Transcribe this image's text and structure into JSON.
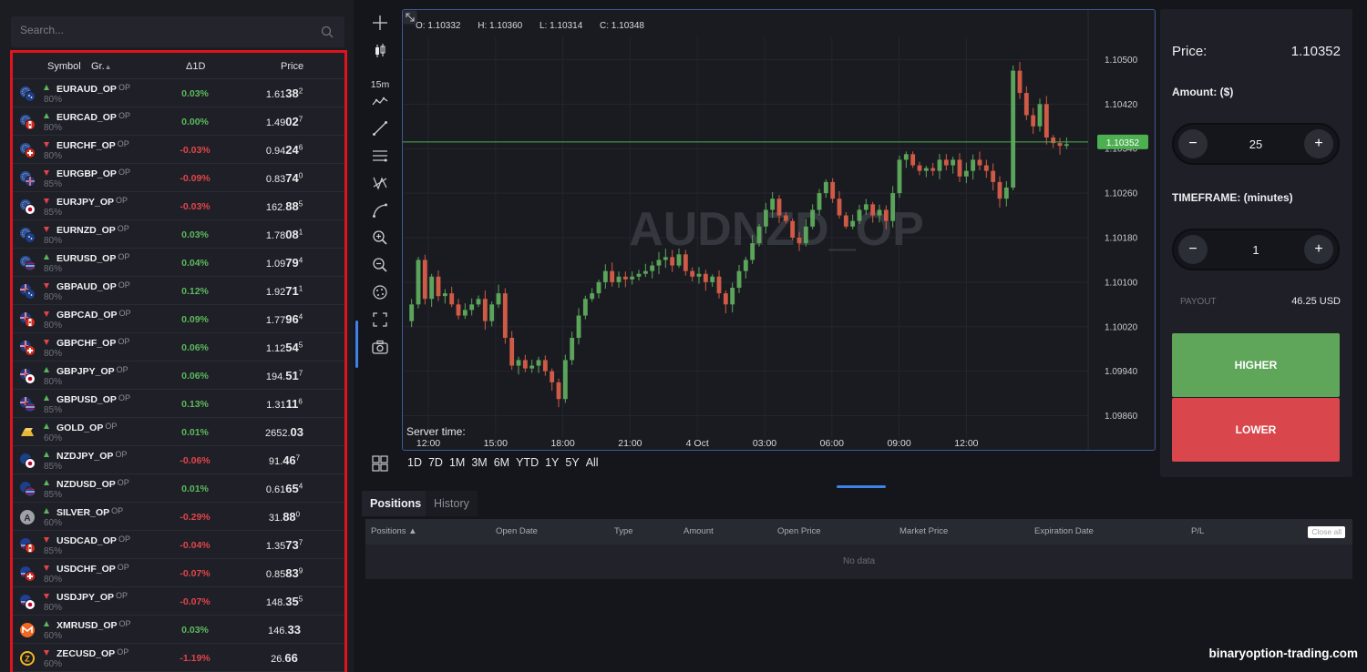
{
  "search": {
    "placeholder": "Search..."
  },
  "instruments": {
    "headers": {
      "symbol": "Symbol",
      "group": "Gr.",
      "change": "Δ1D",
      "price": "Price"
    },
    "rows": [
      {
        "symbol": "EURAUD_OP",
        "tag": "OP",
        "payout": "80%",
        "dir": "up",
        "change": "0.03%",
        "pre": "1.61",
        "big": "38",
        "sup": "2",
        "flag": "eu-au"
      },
      {
        "symbol": "EURCAD_OP",
        "tag": "OP",
        "payout": "80%",
        "dir": "up",
        "change": "0.00%",
        "pre": "1.49",
        "big": "02",
        "sup": "7",
        "flag": "eu-ca"
      },
      {
        "symbol": "EURCHF_OP",
        "tag": "OP",
        "payout": "80%",
        "dir": "down",
        "change": "-0.03%",
        "pre": "0.94",
        "big": "24",
        "sup": "6",
        "flag": "eu-ch"
      },
      {
        "symbol": "EURGBP_OP",
        "tag": "OP",
        "payout": "85%",
        "dir": "down",
        "change": "-0.09%",
        "pre": "0.83",
        "big": "74",
        "sup": "0",
        "flag": "eu-gb"
      },
      {
        "symbol": "EURJPY_OP",
        "tag": "OP",
        "payout": "85%",
        "dir": "down",
        "change": "-0.03%",
        "pre": "162.",
        "big": "88",
        "sup": "5",
        "flag": "eu-jp"
      },
      {
        "symbol": "EURNZD_OP",
        "tag": "OP",
        "payout": "80%",
        "dir": "down",
        "change": "0.03%",
        "pre": "1.78",
        "big": "08",
        "sup": "1",
        "flag": "eu-nz"
      },
      {
        "symbol": "EURUSD_OP",
        "tag": "OP",
        "payout": "86%",
        "dir": "up",
        "change": "0.04%",
        "pre": "1.09",
        "big": "79",
        "sup": "4",
        "flag": "eu-us"
      },
      {
        "symbol": "GBPAUD_OP",
        "tag": "OP",
        "payout": "80%",
        "dir": "down",
        "change": "0.12%",
        "pre": "1.92",
        "big": "71",
        "sup": "1",
        "flag": "gb-au"
      },
      {
        "symbol": "GBPCAD_OP",
        "tag": "OP",
        "payout": "80%",
        "dir": "down",
        "change": "0.09%",
        "pre": "1.77",
        "big": "96",
        "sup": "4",
        "flag": "gb-ca"
      },
      {
        "symbol": "GBPCHF_OP",
        "tag": "OP",
        "payout": "80%",
        "dir": "down",
        "change": "0.06%",
        "pre": "1.12",
        "big": "54",
        "sup": "5",
        "flag": "gb-ch"
      },
      {
        "symbol": "GBPJPY_OP",
        "tag": "OP",
        "payout": "80%",
        "dir": "up",
        "change": "0.06%",
        "pre": "194.",
        "big": "51",
        "sup": "7",
        "flag": "gb-jp"
      },
      {
        "symbol": "GBPUSD_OP",
        "tag": "OP",
        "payout": "85%",
        "dir": "up",
        "change": "0.13%",
        "pre": "1.31",
        "big": "11",
        "sup": "6",
        "flag": "gb-us"
      },
      {
        "symbol": "GOLD_OP",
        "tag": "OP",
        "payout": "60%",
        "dir": "up",
        "change": "0.01%",
        "pre": "2652.",
        "big": "03",
        "sup": "",
        "flag": "gold"
      },
      {
        "symbol": "NZDJPY_OP",
        "tag": "OP",
        "payout": "85%",
        "dir": "up",
        "change": "-0.06%",
        "pre": "91.",
        "big": "46",
        "sup": "7",
        "flag": "nz-jp"
      },
      {
        "symbol": "NZDUSD_OP",
        "tag": "OP",
        "payout": "85%",
        "dir": "up",
        "change": "0.01%",
        "pre": "0.61",
        "big": "65",
        "sup": "4",
        "flag": "nz-us"
      },
      {
        "symbol": "SILVER_OP",
        "tag": "OP",
        "payout": "60%",
        "dir": "up",
        "change": "-0.29%",
        "pre": "31.",
        "big": "88",
        "sup": "0",
        "flag": "silver"
      },
      {
        "symbol": "USDCAD_OP",
        "tag": "OP",
        "payout": "85%",
        "dir": "down",
        "change": "-0.04%",
        "pre": "1.35",
        "big": "73",
        "sup": "7",
        "flag": "us-ca"
      },
      {
        "symbol": "USDCHF_OP",
        "tag": "OP",
        "payout": "80%",
        "dir": "down",
        "change": "-0.07%",
        "pre": "0.85",
        "big": "83",
        "sup": "9",
        "flag": "us-ch"
      },
      {
        "symbol": "USDJPY_OP",
        "tag": "OP",
        "payout": "80%",
        "dir": "down",
        "change": "-0.07%",
        "pre": "148.",
        "big": "35",
        "sup": "5",
        "flag": "us-jp"
      },
      {
        "symbol": "XMRUSD_OP",
        "tag": "OP",
        "payout": "60%",
        "dir": "up",
        "change": "0.03%",
        "pre": "146.",
        "big": "33",
        "sup": "",
        "flag": "xmr"
      },
      {
        "symbol": "ZECUSD_OP",
        "tag": "OP",
        "payout": "60%",
        "dir": "down",
        "change": "-1.19%",
        "pre": "26.",
        "big": "66",
        "sup": "",
        "flag": "zec"
      }
    ]
  },
  "toolbar": {
    "timeframe": "15m"
  },
  "chart": {
    "ohlc": {
      "open": "O: 1.10332",
      "high": "H: 1.10360",
      "low": "L: 1.10314",
      "close": "C: 1.10348"
    },
    "watermark": "AUDNZD_OP",
    "server_time": "Server time:",
    "current_price": "1.10352",
    "ranges": [
      "1D",
      "7D",
      "1M",
      "3M",
      "6M",
      "YTD",
      "1Y",
      "5Y",
      "All"
    ]
  },
  "chart_data": {
    "type": "candlestick",
    "y_ticks": [
      "1.10500",
      "1.10420",
      "1.10340",
      "1.10260",
      "1.10180",
      "1.10100",
      "1.10020",
      "1.09940",
      "1.09860"
    ],
    "ylim": [
      1.0982,
      1.1054
    ],
    "x_ticks": [
      "12:00",
      "15:00",
      "18:00",
      "21:00",
      "4 Oct",
      "03:00",
      "06:00",
      "09:00",
      "12:00"
    ],
    "last_price": 1.10352,
    "line_color": "#4caf50",
    "up_color": "#5ba55a",
    "down_color": "#cf5a45",
    "closes": [
      1.1006,
      1.1014,
      1.1007,
      1.1011,
      1.10075,
      1.1008,
      1.1006,
      1.1004,
      1.1005,
      1.1006,
      1.1007,
      1.1003,
      1.1006,
      1.1008,
      1.1,
      1.0995,
      1.0996,
      1.09945,
      1.0995,
      1.0996,
      1.0994,
      1.0992,
      1.0989,
      1.0996,
      1.1,
      1.1004,
      1.1007,
      1.1008,
      1.101,
      1.1012,
      1.101,
      1.1011,
      1.10105,
      1.1011,
      1.10115,
      1.1012,
      1.1013,
      1.1014,
      1.10145,
      1.1013,
      1.1015,
      1.1012,
      1.1011,
      1.10115,
      1.101,
      1.1011,
      1.1008,
      1.1006,
      1.1009,
      1.1012,
      1.1014,
      1.1017,
      1.102,
      1.1023,
      1.1025,
      1.1022,
      1.1021,
      1.1018,
      1.1017,
      1.102,
      1.1023,
      1.1026,
      1.1028,
      1.1025,
      1.1022,
      1.102,
      1.1021,
      1.1023,
      1.1024,
      1.1022,
      1.1023,
      1.1021,
      1.1026,
      1.1032,
      1.1033,
      1.1031,
      1.103,
      1.10305,
      1.103,
      1.1032,
      1.1031,
      1.1032,
      1.1029,
      1.103,
      1.1032,
      1.1031,
      1.103,
      1.1028,
      1.1025,
      1.1027,
      1.1048,
      1.1044,
      1.104,
      1.1038,
      1.1042,
      1.1036,
      1.1035,
      1.10345,
      1.10348
    ]
  },
  "trade": {
    "price_label": "Price:",
    "price_value": "1.10352",
    "amount_label": "Amount: ($)",
    "amount_value": "25",
    "minus": "−",
    "plus": "+",
    "timeframe_label": "TIMEFRAME: (minutes)",
    "timeframe_value": "1",
    "payout_label": "PAYOUT",
    "payout_value": "46.25 USD",
    "higher": "HIGHER",
    "lower": "LOWER"
  },
  "positions": {
    "tabs": [
      "Positions",
      "History"
    ],
    "columns": [
      "Positions ▲",
      "Open Date",
      "Type",
      "Amount",
      "Open Price",
      "Market Price",
      "Expiration Date",
      "P/L"
    ],
    "close_all": "Close all",
    "empty": "No data"
  },
  "site_watermark": "binaryoption-trading.com"
}
